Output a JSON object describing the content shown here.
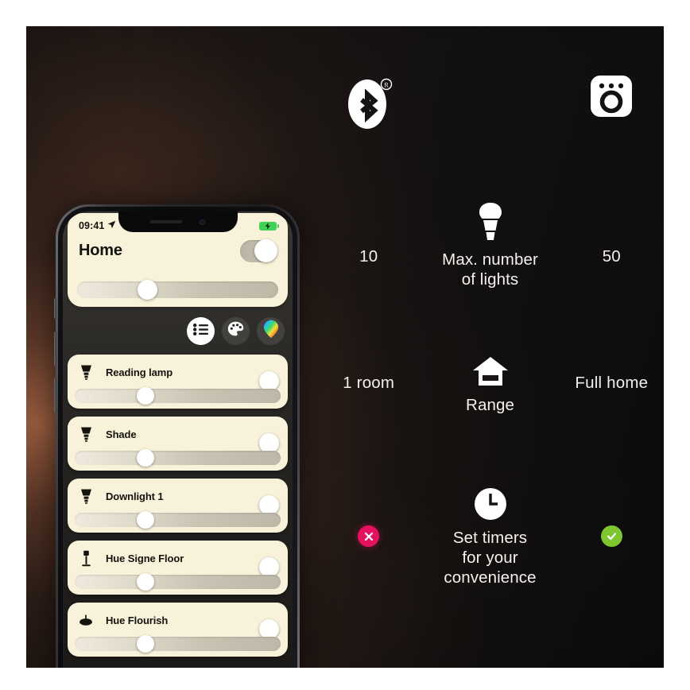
{
  "comparison": {
    "rows": [
      {
        "id": "connectivity",
        "left_value": "",
        "left_icon": "bluetooth-icon",
        "center_label": "",
        "center_icon": "",
        "right_value": "",
        "right_icon": "hue-bridge-icon"
      },
      {
        "id": "max-lights",
        "left_value": "10",
        "center_label": "Max. number\nof lights",
        "center_label_line1": "Max. number",
        "center_label_line2": "of lights",
        "center_icon": "light-bulb-icon",
        "right_value": "50"
      },
      {
        "id": "range",
        "left_value": "1 room",
        "center_label": "Range",
        "center_icon": "house-icon",
        "right_value": "Full home"
      },
      {
        "id": "timers",
        "left_value": "",
        "left_icon": "cross-badge-icon",
        "center_label_line1": "Set timers",
        "center_label_line2": "for your",
        "center_label_line3": "convenience",
        "center_icon": "clock-icon",
        "right_value": "",
        "right_icon": "check-badge-icon"
      }
    ]
  },
  "phone": {
    "status_bar": {
      "time": "09:41",
      "location_icon": "location-arrow-icon",
      "battery_icon": "battery-charging-icon"
    },
    "header": {
      "title": "Home",
      "master_toggle_on": true,
      "brightness_percent": 33
    },
    "mode_buttons": [
      {
        "id": "list",
        "icon": "list-icon",
        "active": true
      },
      {
        "id": "scenes",
        "icon": "palette-icon",
        "active": false
      },
      {
        "id": "colors",
        "icon": "color-picker-icon",
        "active": false
      }
    ],
    "lights": [
      {
        "name": "Reading lamp",
        "icon": "spot-bulb-icon",
        "on": true,
        "brightness_percent": 33
      },
      {
        "name": "Shade",
        "icon": "spot-bulb-icon",
        "on": true,
        "brightness_percent": 33
      },
      {
        "name": "Downlight 1",
        "icon": "spot-bulb-icon",
        "on": true,
        "brightness_percent": 33
      },
      {
        "name": "Hue Signe Floor",
        "icon": "floor-lamp-icon",
        "on": true,
        "brightness_percent": 33
      },
      {
        "name": "Hue Flourish",
        "icon": "ceiling-lamp-icon",
        "on": true,
        "brightness_percent": 33
      }
    ]
  },
  "colors": {
    "card_background": "#f7f2d9",
    "accent_no": "#e6115e",
    "accent_yes": "#7ec62f",
    "battery_green": "#3fd257",
    "text_light": "#f2efec",
    "text_dark": "#15130e"
  }
}
